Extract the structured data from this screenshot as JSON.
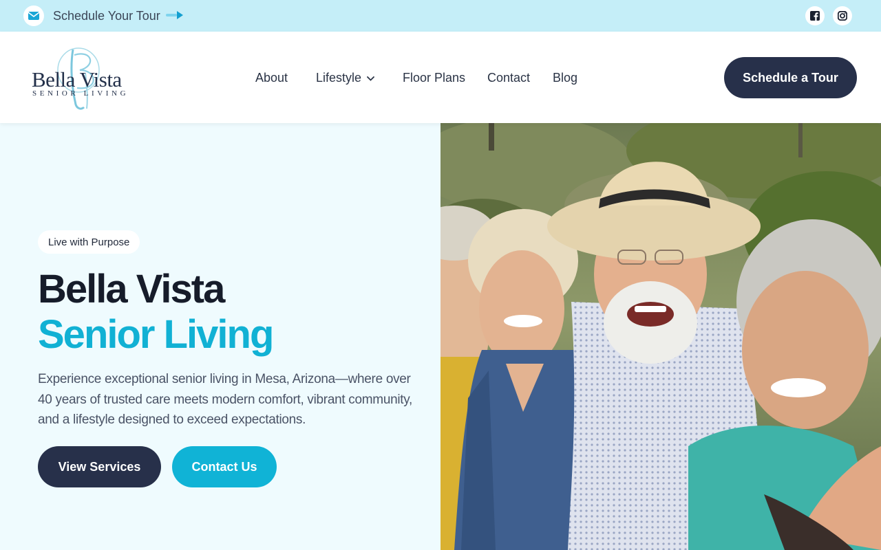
{
  "topbar": {
    "tour_link": "Schedule Your Tour",
    "icons": [
      "mail-icon",
      "arrow-right-icon",
      "facebook-icon",
      "instagram-icon"
    ]
  },
  "logo": {
    "brand": "Bella Vista",
    "subtitle": "SENIOR LIVING",
    "monogram": "BV"
  },
  "nav": {
    "items": [
      {
        "label": "About"
      },
      {
        "label": "Lifestyle",
        "has_dropdown": true
      },
      {
        "label": "Floor Plans"
      },
      {
        "label": "Contact"
      },
      {
        "label": "Blog"
      }
    ],
    "cta": "Schedule a Tour"
  },
  "hero": {
    "badge": "Live with Purpose",
    "title_line1": "Bella Vista",
    "title_line2": "Senior Living",
    "description": "Experience exceptional senior living in Mesa, Arizona—where over 40 years of trusted care meets modern comfort, vibrant community, and a lifestyle designed to exceed expectations.",
    "primary_button": "View Services",
    "secondary_button": "Contact Us",
    "image_subject": "group of smiling seniors outdoors"
  },
  "colors": {
    "topbar_bg": "#c5eef8",
    "navy": "#27304a",
    "accent": "#11b1d4",
    "hero_bg": "#effbfe"
  }
}
